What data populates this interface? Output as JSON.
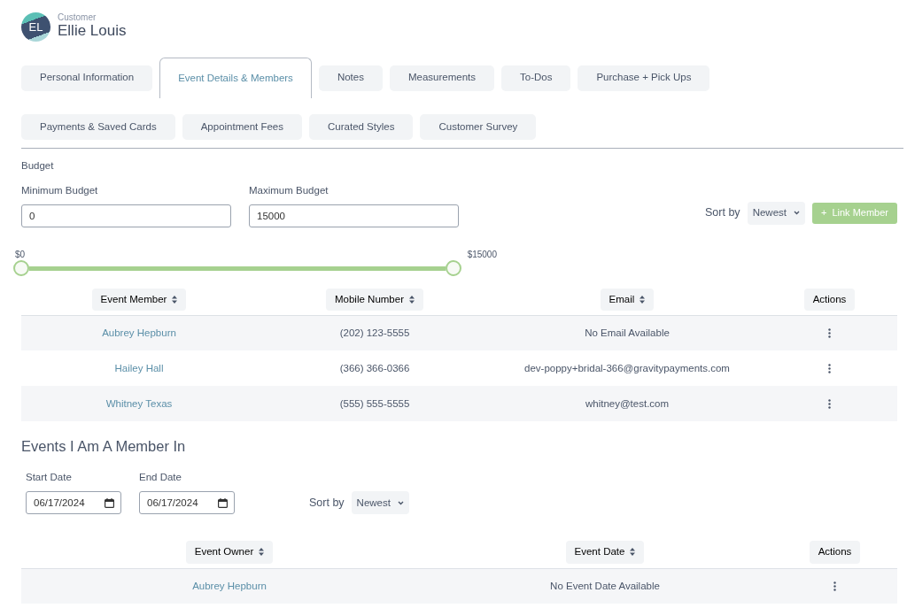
{
  "customer": {
    "initials": "EL",
    "caption": "Customer",
    "name": "Ellie Louis"
  },
  "tabs": [
    {
      "label": "Personal Information",
      "selected": false
    },
    {
      "label": "Event Details & Members",
      "selected": true
    },
    {
      "label": "Notes",
      "selected": false
    },
    {
      "label": "Measurements",
      "selected": false
    },
    {
      "label": "To-Dos",
      "selected": false
    },
    {
      "label": "Purchase + Pick Ups",
      "selected": false
    },
    {
      "label": "Payments & Saved Cards",
      "selected": false
    },
    {
      "label": "Appointment Fees",
      "selected": false
    },
    {
      "label": "Curated Styles",
      "selected": false
    },
    {
      "label": "Customer Survey",
      "selected": false
    }
  ],
  "budget": {
    "title": "Budget",
    "min_label": "Minimum Budget",
    "min_value": "0",
    "max_label": "Maximum Budget",
    "max_value": "15000",
    "slider": {
      "min_label": "$0",
      "max_label": "$15000",
      "thumbs": [
        {
          "level": 0
        },
        {
          "level": 1
        }
      ]
    }
  },
  "members_toolbar": {
    "sort_label": "Sort by",
    "sort_value": "Newest",
    "button_icon": "+",
    "button_label": "Link Member"
  },
  "members_table": {
    "columns": [
      {
        "label": "Event Member",
        "sortable": true
      },
      {
        "label": "Mobile Number",
        "sortable": true
      },
      {
        "label": "Email",
        "sortable": true
      },
      {
        "label": "Actions",
        "sortable": false
      }
    ],
    "rows": [
      {
        "name": "Aubrey Hepburn",
        "mobile": "(202) 123-5555",
        "email": "No Email Available"
      },
      {
        "name": "Hailey Hall",
        "mobile": "(366) 366-0366",
        "email": "dev-poppy+bridal-366@gravitypayments.com"
      },
      {
        "name": "Whitney Texas",
        "mobile": "(555) 555-5555",
        "email": "whitney@test.com"
      }
    ]
  },
  "events": {
    "title": "Events I Am A Member In",
    "start_label": "Start Date",
    "start_value": "06/17/2024",
    "end_label": "End Date",
    "end_value": "06/17/2024",
    "sort_label": "Sort by",
    "sort_value": "Newest",
    "table": {
      "columns": [
        {
          "label": "Event Owner",
          "sortable": true
        },
        {
          "label": "Event Date",
          "sortable": true
        },
        {
          "label": "Actions",
          "sortable": false
        }
      ],
      "rows": [
        {
          "owner": "Aubrey Hepburn",
          "date": "No Event Date Available"
        }
      ]
    }
  }
}
